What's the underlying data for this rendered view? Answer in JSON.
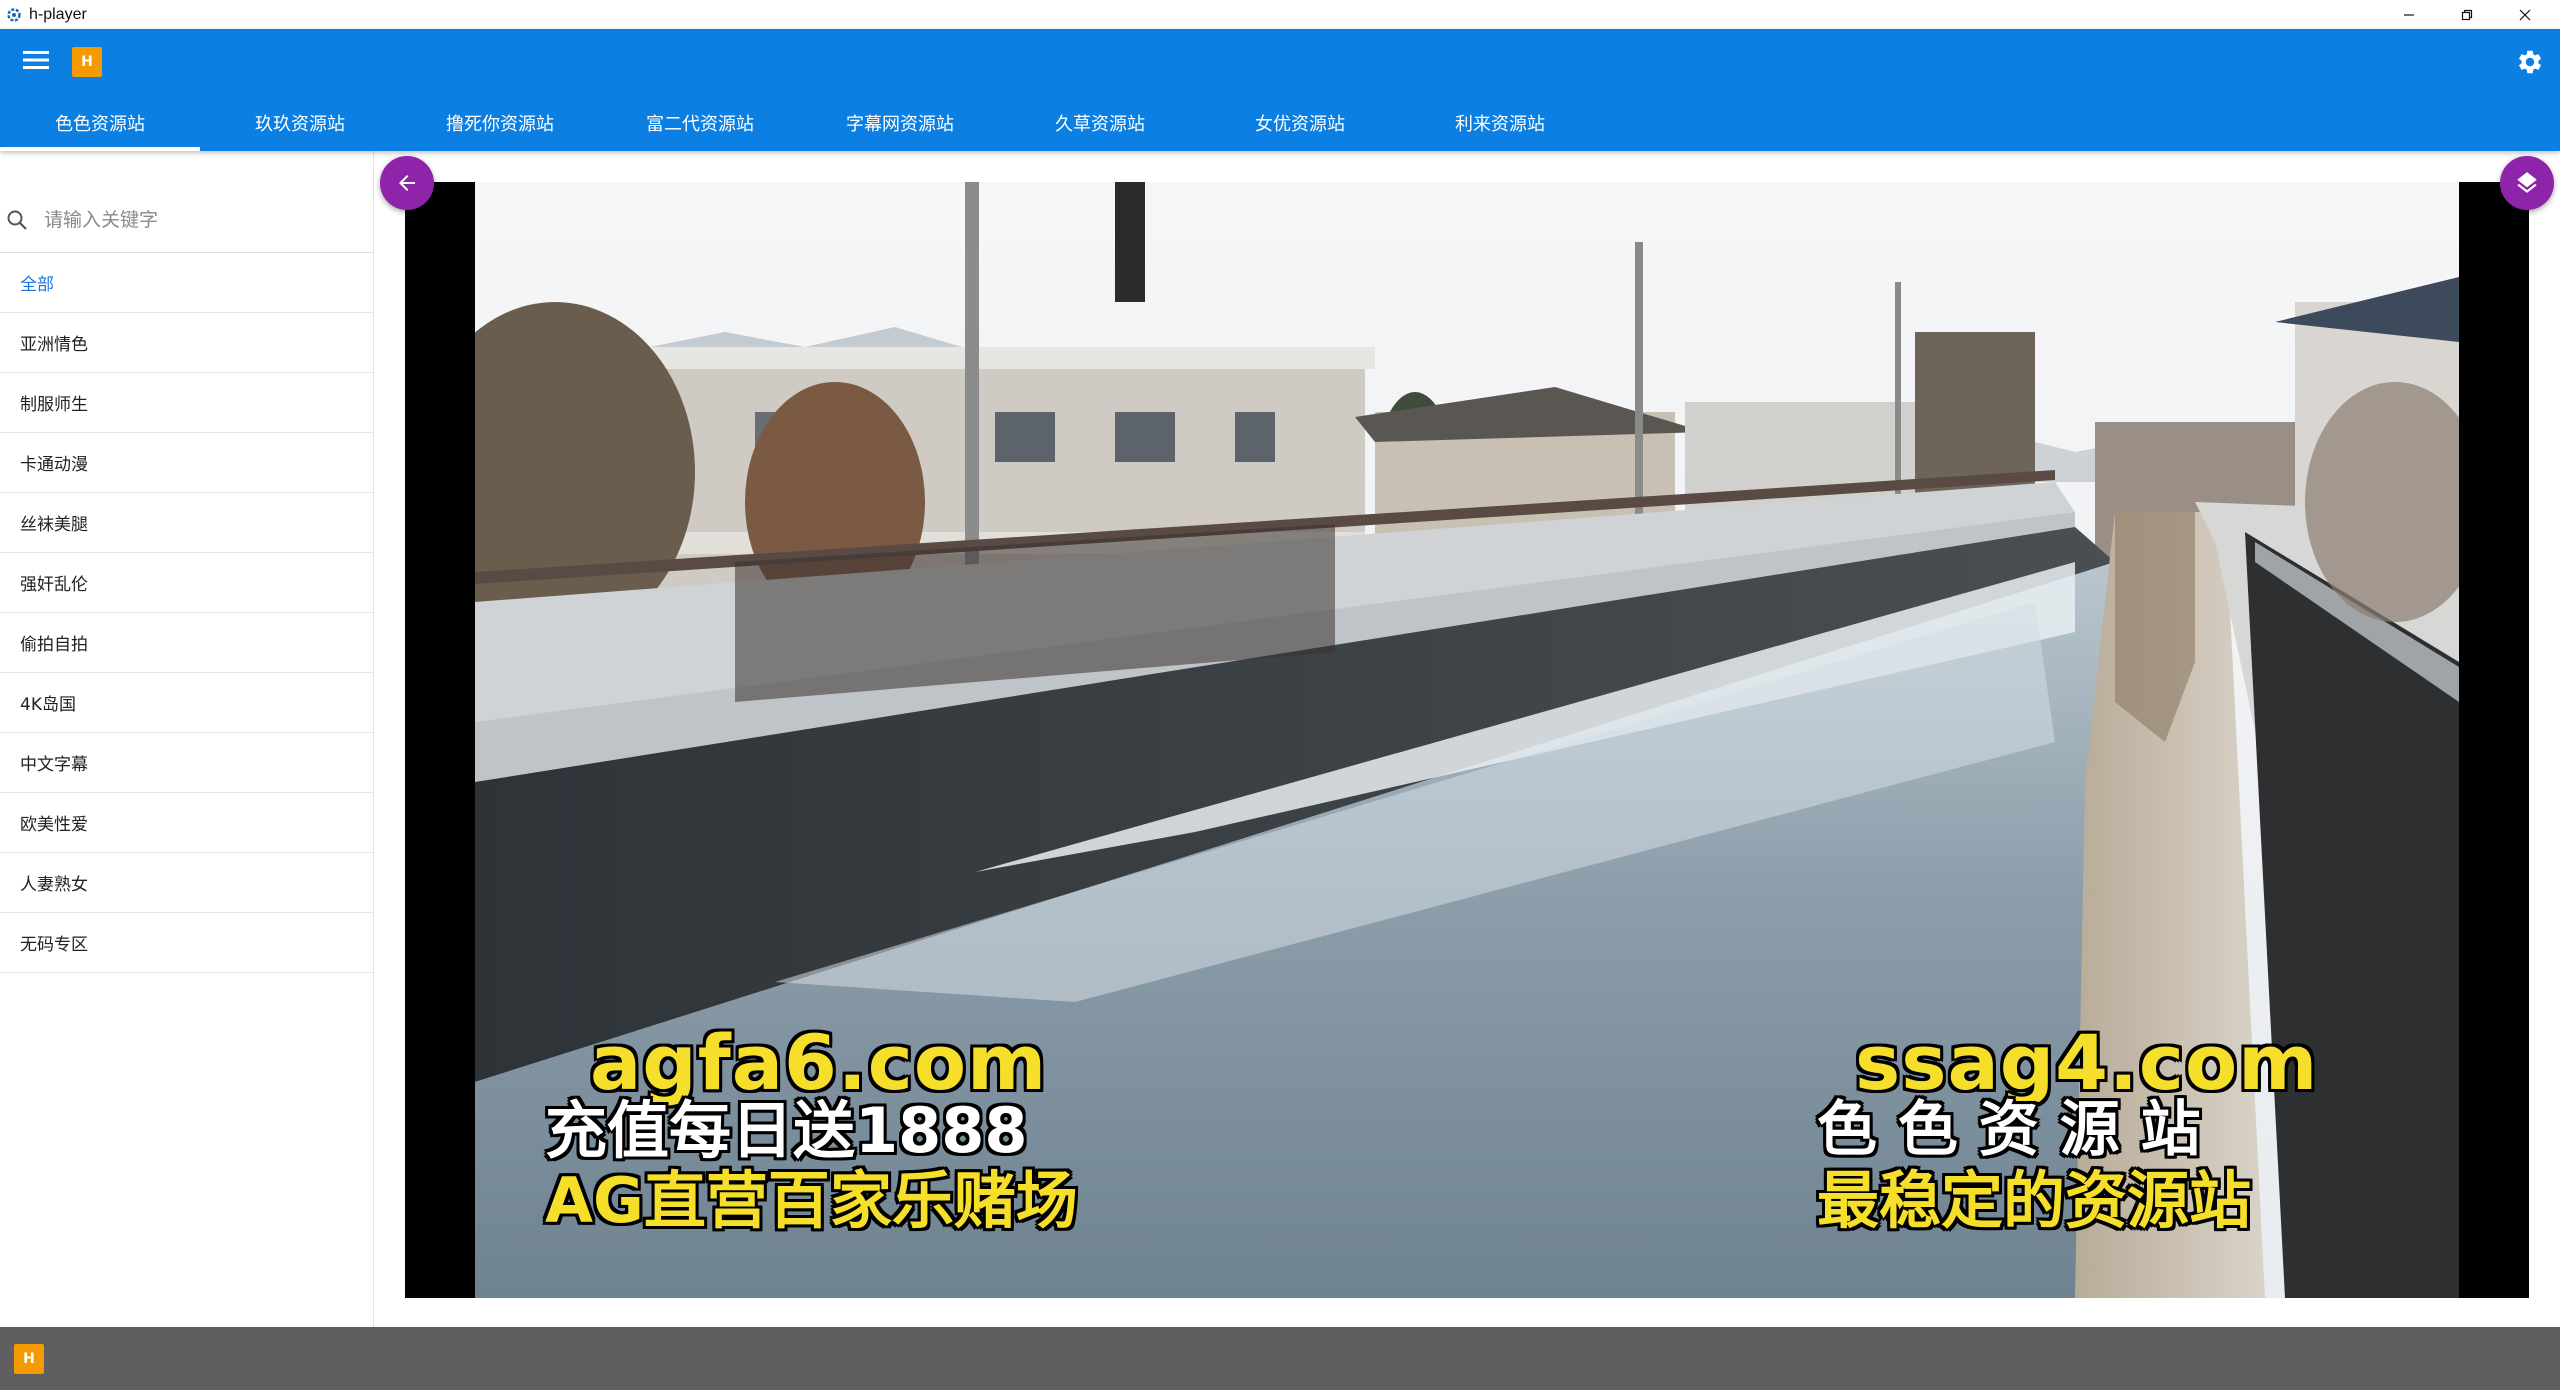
{
  "window": {
    "title": "h-player",
    "icons": {
      "app": "gear-logo-icon",
      "minimize": "minimize-icon",
      "restore": "restore-icon",
      "close": "close-icon"
    }
  },
  "appbar": {
    "logo_letter": "H",
    "menu_icon": "hamburger-menu-icon",
    "settings_icon": "gear-icon",
    "accent": "#0c7fe3",
    "tabs": [
      {
        "label": "色色资源站",
        "active": true
      },
      {
        "label": "玖玖资源站"
      },
      {
        "label": "撸死你资源站"
      },
      {
        "label": "富二代资源站"
      },
      {
        "label": "字幕网资源站"
      },
      {
        "label": "久草资源站"
      },
      {
        "label": "女优资源站"
      },
      {
        "label": "利来资源站"
      }
    ]
  },
  "sidebar": {
    "search_placeholder": "请输入关键字",
    "search_icon": "search-icon",
    "categories": [
      {
        "label": "全部",
        "active": true
      },
      {
        "label": "亚洲情色"
      },
      {
        "label": "制服师生"
      },
      {
        "label": "卡通动漫"
      },
      {
        "label": "丝袜美腿"
      },
      {
        "label": "强奸乱伦"
      },
      {
        "label": "偷拍自拍"
      },
      {
        "label": "4K岛国"
      },
      {
        "label": "中文字幕"
      },
      {
        "label": "欧美性爱"
      },
      {
        "label": "人妻熟女"
      },
      {
        "label": "无码专区"
      }
    ]
  },
  "player": {
    "back_icon": "arrow-left-icon",
    "layers_icon": "layers-icon",
    "fab_color": "#8e24aa",
    "watermark_left": [
      "agfa6.com",
      "充值每日送1888",
      "AG直营百家乐赌场"
    ],
    "watermark_right": [
      "ssag4.com",
      "色 色 资 源 站",
      "最稳定的资源站"
    ]
  },
  "bottombar": {
    "logo_letter": "H"
  }
}
